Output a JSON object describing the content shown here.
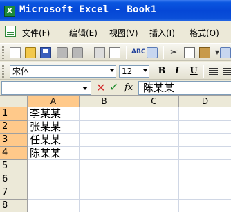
{
  "window": {
    "title": "Microsoft Excel - Book1"
  },
  "menu": [
    "文件(F)",
    "编辑(E)",
    "视图(V)",
    "插入(I)",
    "格式(O)"
  ],
  "format_toolbar": {
    "font": "宋体",
    "size": "12",
    "bold": "B",
    "italic": "I",
    "underline": "U"
  },
  "formula_bar": {
    "cell_name": "",
    "cancel_symbol": "✕",
    "enter_symbol": "✓",
    "fx_label": "fx",
    "content": "陈某某"
  },
  "columns": [
    "A",
    "B",
    "C",
    "D"
  ],
  "rows": [
    "1",
    "2",
    "3",
    "4",
    "5",
    "6",
    "7",
    "8"
  ],
  "cells": {
    "A1": "李某某",
    "A2": "张某某",
    "A3": "任某某",
    "A4": "陈某某"
  },
  "toolbar_icons": [
    "new-icon",
    "open-icon",
    "save-icon",
    "permission-icon",
    "print-icon",
    "print-preview-icon",
    "spelling-icon",
    "research-icon",
    "cut-icon",
    "copy-icon",
    "paste-icon",
    "format-painter-icon"
  ],
  "colors": {
    "title_bar": "#0a56e0",
    "selected_header": "#ffc98a",
    "grid_line": "#d0d7e5"
  }
}
